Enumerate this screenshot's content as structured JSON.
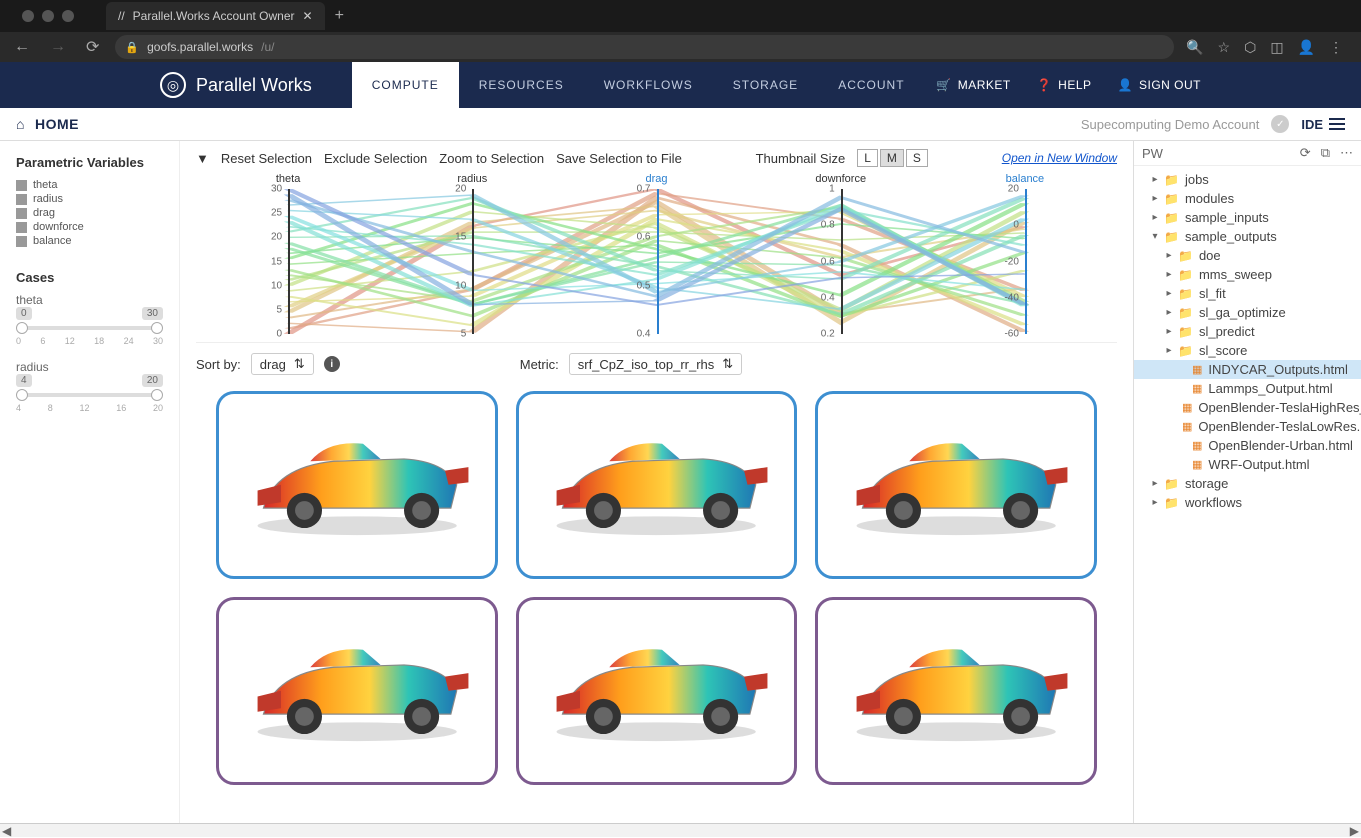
{
  "browser": {
    "tab_title": "Parallel.Works Account Owner",
    "url_host": "goofs.parallel.works",
    "url_path": "/u/",
    "icons": {
      "lock": "🔒",
      "back": "←",
      "forward": "→",
      "reload": "⟳",
      "close": "✕",
      "plus": "+",
      "search": "🔍",
      "star": "☆",
      "shield": "⬡",
      "ext": "⋯",
      "avatar": "👤",
      "menu": "⋮"
    }
  },
  "brand": {
    "name": "Parallel Works"
  },
  "nav": {
    "items": [
      "COMPUTE",
      "RESOURCES",
      "WORKFLOWS",
      "STORAGE",
      "ACCOUNT"
    ],
    "active": "COMPUTE"
  },
  "header_right": {
    "market": "MARKET",
    "help": "HELP",
    "signout": "SIGN OUT"
  },
  "subheader": {
    "home": "HOME",
    "account": "Supecomputing Demo Account",
    "ide": "IDE"
  },
  "left": {
    "vars_title": "Parametric Variables",
    "vars": [
      "theta",
      "radius",
      "drag",
      "downforce",
      "balance"
    ],
    "cases_title": "Cases",
    "sliders": [
      {
        "name": "theta",
        "min": "0",
        "max": "30",
        "ticks": [
          "0",
          "6",
          "12",
          "18",
          "24",
          "30"
        ]
      },
      {
        "name": "radius",
        "min": "4",
        "max": "20",
        "ticks": [
          "4",
          "8",
          "12",
          "16",
          "20"
        ]
      }
    ]
  },
  "toolbar": {
    "reset": "Reset Selection",
    "exclude": "Exclude Selection",
    "zoom": "Zoom to Selection",
    "save": "Save Selection to File",
    "thumb_label": "Thumbnail Size",
    "sizes": [
      "L",
      "M",
      "S"
    ],
    "active_size": "M",
    "open_window": "Open in New Window"
  },
  "chart_data": {
    "type": "parallel-coordinates",
    "axes": [
      {
        "name": "theta",
        "range": [
          0,
          30
        ],
        "ticks": [
          0,
          5,
          10,
          15,
          20,
          25,
          30
        ],
        "highlight": false
      },
      {
        "name": "radius",
        "range": [
          5,
          20
        ],
        "ticks": [
          5,
          10,
          15,
          20
        ],
        "highlight": false
      },
      {
        "name": "drag",
        "range": [
          0.4,
          0.7
        ],
        "ticks": [
          0.4,
          0.5,
          0.6,
          0.7
        ],
        "highlight": true
      },
      {
        "name": "downforce",
        "range": [
          0.2,
          1.0
        ],
        "ticks": [
          0.2,
          0.4,
          0.6,
          0.8,
          1.0
        ],
        "highlight": false
      },
      {
        "name": "balance",
        "range": [
          -60,
          20
        ],
        "ticks": [
          -60,
          -40,
          -20,
          0,
          20
        ],
        "highlight": true
      }
    ],
    "n_lines_approx": 30,
    "color_scale": "red-to-blue by drag"
  },
  "controls": {
    "sort_label": "Sort by:",
    "sort_value": "drag",
    "metric_label": "Metric:",
    "metric_value": "srf_CpZ_iso_top_rr_rhs"
  },
  "thumbs": {
    "colors": [
      "blue",
      "blue",
      "blue",
      "purple",
      "purple",
      "purple"
    ]
  },
  "tree": {
    "root": "PW",
    "items": [
      {
        "type": "folder",
        "name": "jobs",
        "indent": 1,
        "expanded": false
      },
      {
        "type": "folder",
        "name": "modules",
        "indent": 1,
        "expanded": false
      },
      {
        "type": "folder",
        "name": "sample_inputs",
        "indent": 1,
        "expanded": false
      },
      {
        "type": "folder",
        "name": "sample_outputs",
        "indent": 1,
        "expanded": true
      },
      {
        "type": "folder",
        "name": "doe",
        "indent": 2,
        "expanded": false
      },
      {
        "type": "folder",
        "name": "mms_sweep",
        "indent": 2,
        "expanded": false
      },
      {
        "type": "folder",
        "name": "sl_fit",
        "indent": 2,
        "expanded": false
      },
      {
        "type": "folder",
        "name": "sl_ga_optimize",
        "indent": 2,
        "expanded": false
      },
      {
        "type": "folder",
        "name": "sl_predict",
        "indent": 2,
        "expanded": false
      },
      {
        "type": "folder",
        "name": "sl_score",
        "indent": 2,
        "expanded": false
      },
      {
        "type": "file",
        "name": "INDYCAR_Outputs.html",
        "indent": 3,
        "selected": true
      },
      {
        "type": "file",
        "name": "Lammps_Output.html",
        "indent": 3
      },
      {
        "type": "file",
        "name": "OpenBlender-TeslaHighRes_html",
        "indent": 3
      },
      {
        "type": "file",
        "name": "OpenBlender-TeslaLowRes.html",
        "indent": 3
      },
      {
        "type": "file",
        "name": "OpenBlender-Urban.html",
        "indent": 3
      },
      {
        "type": "file",
        "name": "WRF-Output.html",
        "indent": 3
      },
      {
        "type": "folder",
        "name": "storage",
        "indent": 1,
        "expanded": false
      },
      {
        "type": "folder",
        "name": "workflows",
        "indent": 1,
        "expanded": false
      }
    ]
  }
}
